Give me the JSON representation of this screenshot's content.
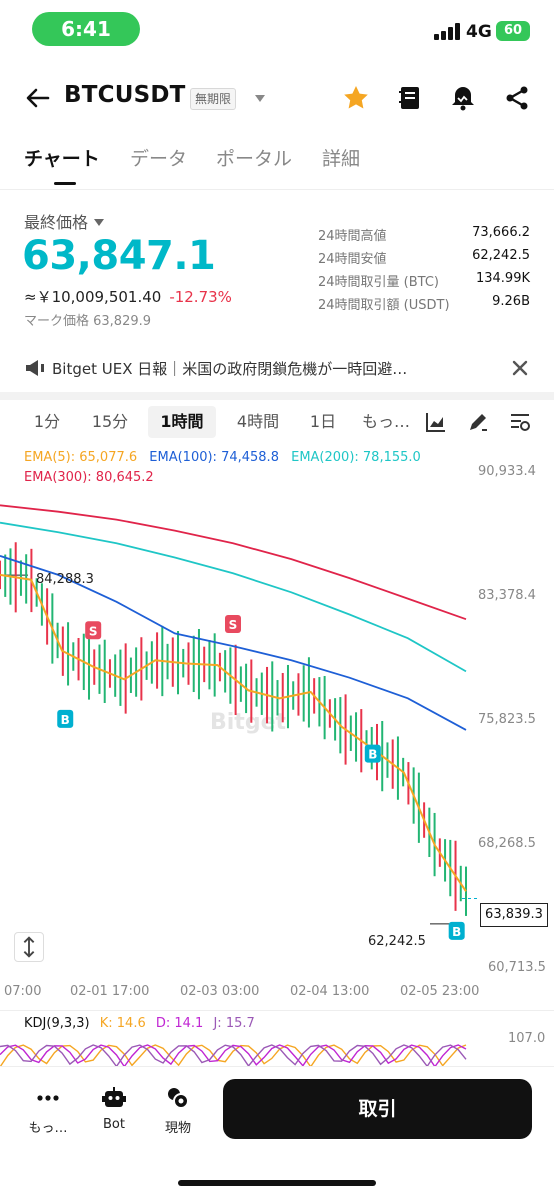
{
  "status": {
    "time": "6:41",
    "network": "4G",
    "battery": "60"
  },
  "header": {
    "title": "BTCUSDT",
    "tag": "無期限",
    "icons": [
      "back-arrow-icon",
      "star-icon",
      "notebook-icon",
      "alert-icon",
      "share-icon"
    ],
    "star_color": "#f5a623"
  },
  "tabs": [
    {
      "label": "チャート",
      "active": true
    },
    {
      "label": "データ",
      "active": false
    },
    {
      "label": "ポータル",
      "active": false
    },
    {
      "label": "詳細",
      "active": false
    }
  ],
  "price": {
    "label": "最終価格",
    "last": "63,847.1",
    "fiat": "≈￥10,009,501.40",
    "change": "-12.73%",
    "mark": "マーク価格 63,829.9",
    "color": "#00b8c8",
    "change_color": "#e8334a"
  },
  "stats": [
    {
      "label": "24時間高値",
      "value": "73,666.2"
    },
    {
      "label": "24時間安値",
      "value": "62,242.5"
    },
    {
      "label": "24時間取引量 (BTC)",
      "value": "134.99K"
    },
    {
      "label": "24時間取引額 (USDT)",
      "value": "9.26B"
    }
  ],
  "news": {
    "text": "Bitget UEX 日報｜米国の政府閉鎖危機が一時回避…",
    "icons": [
      "megaphone-icon",
      "close-icon"
    ]
  },
  "intervals": {
    "items": [
      {
        "label": "1分",
        "active": false
      },
      {
        "label": "15分",
        "active": false
      },
      {
        "label": "1時間",
        "active": true
      },
      {
        "label": "4時間",
        "active": false
      },
      {
        "label": "1日",
        "active": false
      },
      {
        "label": "もっ…",
        "active": false
      }
    ],
    "icons": [
      "indicator-chart-icon",
      "draw-pen-icon",
      "chart-settings-icon"
    ]
  },
  "chart": {
    "watermark": "Bitget",
    "high_label": "84,288.3",
    "low_label": "62,242.5",
    "current_price": "63,839.3",
    "scale_icon": "vertical-scale-icon"
  },
  "chart_data": {
    "type": "line",
    "title": "",
    "y_ticks": [
      "90,933.4",
      "83,378.4",
      "75,823.5",
      "68,268.5",
      "60,713.5"
    ],
    "x_ticks": [
      "07:00",
      "02-01 17:00",
      "02-03 03:00",
      "02-04 13:00",
      "02-05 23:00"
    ],
    "ylim": [
      60713.5,
      90933.4
    ],
    "legend": [
      {
        "name": "EMA(5): 65,077.6",
        "color": "#f5a623"
      },
      {
        "name": "EMA(100): 74,458.8",
        "color": "#1e5fd6"
      },
      {
        "name": "EMA(200): 78,155.0",
        "color": "#1fc6c6"
      },
      {
        "name": "EMA(300): 80,645.2",
        "color": "#e0244a"
      }
    ],
    "series": [
      {
        "name": "EMA(300)",
        "color": "#e0244a",
        "values": [
          88700,
          88300,
          87800,
          87100,
          86300,
          85300,
          84100,
          82800,
          81500
        ]
      },
      {
        "name": "EMA(200)",
        "color": "#1fc6c6",
        "values": [
          87600,
          87000,
          86300,
          85400,
          84400,
          83200,
          81800,
          80300,
          78200
        ]
      },
      {
        "name": "EMA(100)",
        "color": "#1e5fd6",
        "values": [
          85500,
          84300,
          82600,
          80600,
          79800,
          78900,
          77800,
          76500,
          74500
        ]
      },
      {
        "name": "EMA(5)",
        "color": "#f5a623",
        "values": [
          84300,
          84000,
          79500,
          78500,
          77700,
          78900,
          78700,
          78600,
          77000,
          76500,
          76900,
          74700,
          73300,
          71800,
          67200,
          64300
        ]
      }
    ],
    "markers": [
      {
        "label": "S",
        "color": "#e84a5f",
        "value": 80800,
        "pos": 0.2
      },
      {
        "label": "B",
        "color": "#00b0d0",
        "value": 75200,
        "pos": 0.14
      },
      {
        "label": "S",
        "color": "#e84a5f",
        "value": 81200,
        "pos": 0.5
      },
      {
        "label": "B",
        "color": "#00b0d0",
        "value": 73000,
        "pos": 0.8
      },
      {
        "label": "B",
        "color": "#00b0d0",
        "value": 61800,
        "pos": 0.98
      }
    ]
  },
  "kdj": {
    "name": "KDJ(9,3,3)",
    "k": "K: 14.6",
    "d": "D: 14.1",
    "j": "J: 15.7",
    "axis": "107.0",
    "k_color": "#f5a623",
    "d_color": "#c026d3",
    "j_color": "#9b59b6"
  },
  "bottom": {
    "items": [
      {
        "label": "もっ…",
        "icon": "more-dots-icon"
      },
      {
        "label": "Bot",
        "icon": "bot-icon"
      },
      {
        "label": "現物",
        "icon": "coins-icon"
      }
    ],
    "trade_label": "取引"
  }
}
